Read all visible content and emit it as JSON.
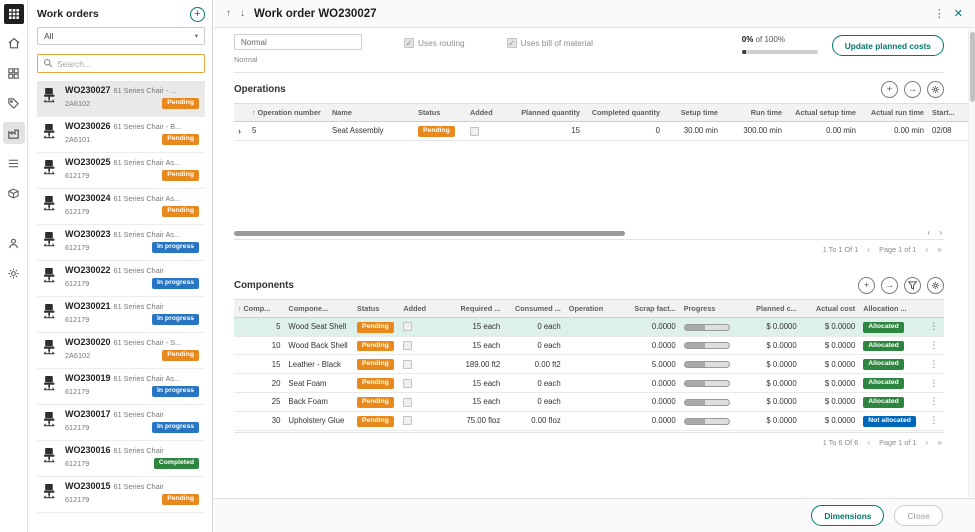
{
  "colors": {
    "accent_teal": "#00786d",
    "pending_orange": "#e8891d",
    "in_progress_blue": "#2876c2",
    "completed_green": "#2e8540",
    "allocated_green": "#2e8540",
    "not_allocated_blue": "#0067b8",
    "selected_row_teal": "#def0ea",
    "search_focus_orange": "#e9a63b"
  },
  "icon_rail": {
    "items": [
      "app-launcher",
      "home",
      "modules",
      "tag",
      "production",
      "list",
      "inventory",
      "user",
      "settings"
    ],
    "active_item": "production"
  },
  "work_orders_panel": {
    "title": "Work orders",
    "add_button": "+",
    "filter_value": "All",
    "search_placeholder": "Search...",
    "items": [
      {
        "id": "WO230027",
        "desc": "61 Series Chair - ...",
        "item": "2A6102",
        "status": "Pending",
        "selected": true
      },
      {
        "id": "WO230026",
        "desc": "61 Series Chair - B...",
        "item": "2A6101",
        "status": "Pending"
      },
      {
        "id": "WO230025",
        "desc": "61 Series Chair As...",
        "item": "612179",
        "status": "Pending"
      },
      {
        "id": "WO230024",
        "desc": "61 Series Chair As...",
        "item": "612179",
        "status": "Pending"
      },
      {
        "id": "WO230023",
        "desc": "61 Series Chair As...",
        "item": "612179",
        "status": "In progress"
      },
      {
        "id": "WO230022",
        "desc": "61 Series Chair",
        "item": "612179",
        "status": "In progress"
      },
      {
        "id": "WO230021",
        "desc": "61 Series Chair",
        "item": "612179",
        "status": "In progress"
      },
      {
        "id": "WO230020",
        "desc": "61 Series Chair - S...",
        "item": "2A6102",
        "status": "Pending"
      },
      {
        "id": "WO230019",
        "desc": "61 Series Chair As...",
        "item": "612179",
        "status": "In progress"
      },
      {
        "id": "WO230017",
        "desc": "61 Series Chair",
        "item": "612179",
        "status": "In progress"
      },
      {
        "id": "WO230016",
        "desc": "61 Series Chair",
        "item": "612179",
        "status": "Completed"
      },
      {
        "id": "WO230015",
        "desc": "61 Series Chair",
        "item": "612179",
        "status": "Pending"
      }
    ]
  },
  "detail": {
    "title": "Work order WO230027",
    "form": {
      "field_value": "Normal",
      "field_caption": "Normal",
      "uses_routing_label": "Uses routing",
      "uses_bom_label": "Uses bill of material",
      "progress_value": "0%",
      "progress_suffix": "of 100%",
      "update_costs_button": "Update planned costs"
    },
    "operations": {
      "title": "Operations",
      "sort_column": "Operation number",
      "columns": [
        "Name",
        "Status",
        "Added",
        "Planned quantity",
        "Completed quantity",
        "Setup time",
        "Run time",
        "Actual setup time",
        "Actual run time",
        "Start..."
      ],
      "rows": [
        {
          "number": "5",
          "name": "Seat Assembly",
          "status": "Pending",
          "planned_quantity": "15",
          "completed_quantity": "0",
          "setup_time": "30.00 min",
          "run_time": "300.00 min",
          "actual_setup_time": "0.00 min",
          "actual_run_time": "0.00 min",
          "start": "02/08"
        }
      ],
      "pagination": {
        "range": "1 To 1 Of 1",
        "page": "Page 1 of 1"
      }
    },
    "components": {
      "title": "Components",
      "sort_column": "Comp...",
      "columns": [
        "Compone...",
        "Status",
        "Added",
        "Required ...",
        "Consumed ...",
        "Operation",
        "Scrap fact...",
        "Progress",
        "Planned c...",
        "Actual cost",
        "Allocation ..."
      ],
      "rows": [
        {
          "num": "5",
          "name": "Wood Seat Shell",
          "status": "Pending",
          "required": "15 each",
          "consumed": "0 each",
          "operation": "",
          "scrap": "0.0000",
          "planned": "$ 0.0000",
          "actual": "$ 0.0000",
          "allocation": "Allocated",
          "selected": true
        },
        {
          "num": "10",
          "name": "Wood Back Shell",
          "status": "Pending",
          "required": "15 each",
          "consumed": "0 each",
          "operation": "",
          "scrap": "0.0000",
          "planned": "$ 0.0000",
          "actual": "$ 0.0000",
          "allocation": "Allocated"
        },
        {
          "num": "15",
          "name": "Leather - Black",
          "status": "Pending",
          "required": "189.00 ft2",
          "consumed": "0.00 ft2",
          "operation": "",
          "scrap": "5.0000",
          "planned": "$ 0.0000",
          "actual": "$ 0.0000",
          "allocation": "Allocated"
        },
        {
          "num": "20",
          "name": "Seat Foam",
          "status": "Pending",
          "required": "15 each",
          "consumed": "0 each",
          "operation": "",
          "scrap": "0.0000",
          "planned": "$ 0.0000",
          "actual": "$ 0.0000",
          "allocation": "Allocated"
        },
        {
          "num": "25",
          "name": "Back Foam",
          "status": "Pending",
          "required": "15 each",
          "consumed": "0 each",
          "operation": "",
          "scrap": "0.0000",
          "planned": "$ 0.0000",
          "actual": "$ 0.0000",
          "allocation": "Allocated"
        },
        {
          "num": "30",
          "name": "Upholstery Glue",
          "status": "Pending",
          "required": "75.00 floz",
          "consumed": "0.00 floz",
          "operation": "",
          "scrap": "0.0000",
          "planned": "$ 0.0000",
          "actual": "$ 0.0000",
          "allocation": "Not allocated"
        }
      ],
      "pagination": {
        "range": "1 To 6 Of 6",
        "page": "Page 1 of 1"
      }
    },
    "footer": {
      "dimensions_button": "Dimensions",
      "close_button": "Close"
    }
  }
}
